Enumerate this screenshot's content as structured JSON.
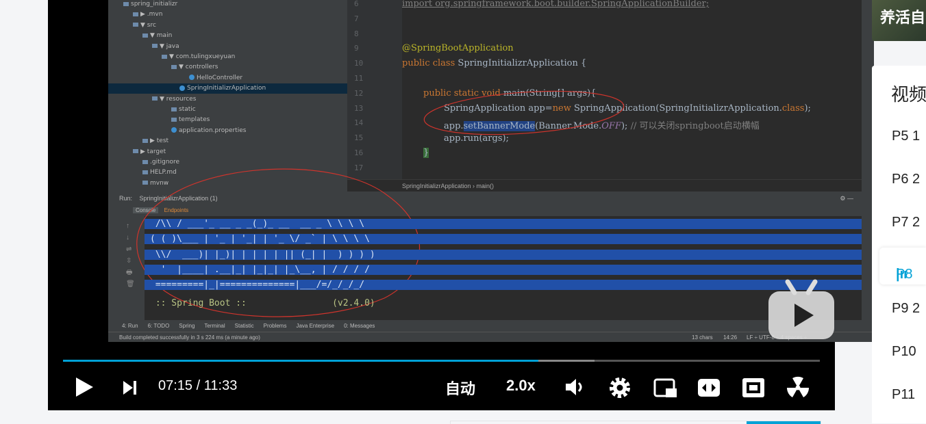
{
  "project_tree": [
    {
      "label": "spring_initializr",
      "indent": 22,
      "sel": false,
      "icon": "folder"
    },
    {
      "label": "▶ .mvn",
      "indent": 36,
      "sel": false,
      "icon": "folder"
    },
    {
      "label": "▼ src",
      "indent": 36,
      "sel": false,
      "icon": "folder"
    },
    {
      "label": "▼ main",
      "indent": 50,
      "sel": false,
      "icon": "folder"
    },
    {
      "label": "▼ java",
      "indent": 64,
      "sel": false,
      "icon": "folder"
    },
    {
      "label": "▼ com.tulingxueyuan",
      "indent": 78,
      "sel": false,
      "icon": "folder"
    },
    {
      "label": "▼ controllers",
      "indent": 92,
      "sel": false,
      "icon": "folder"
    },
    {
      "label": "HelloController",
      "indent": 118,
      "sel": false,
      "icon": "class"
    },
    {
      "label": "SpringInitializrApplication",
      "indent": 104,
      "sel": true,
      "icon": "class"
    },
    {
      "label": "▼ resources",
      "indent": 64,
      "sel": false,
      "icon": "folder"
    },
    {
      "label": "static",
      "indent": 92,
      "sel": false,
      "icon": "folder"
    },
    {
      "label": "templates",
      "indent": 92,
      "sel": false,
      "icon": "folder"
    },
    {
      "label": "application.properties",
      "indent": 92,
      "sel": false,
      "icon": "class"
    },
    {
      "label": "▶ test",
      "indent": 50,
      "sel": false,
      "icon": "folder"
    },
    {
      "label": "▶ target",
      "indent": 36,
      "sel": false,
      "icon": "folder"
    },
    {
      "label": ".gitignore",
      "indent": 50,
      "sel": false,
      "icon": "file"
    },
    {
      "label": "HELP.md",
      "indent": 50,
      "sel": false,
      "icon": "file"
    },
    {
      "label": "mvnw",
      "indent": 50,
      "sel": false,
      "icon": "file"
    }
  ],
  "editor": {
    "line_numbers": [
      "6",
      "7",
      "8",
      "9",
      "10",
      "11",
      "12",
      "13",
      "14",
      "15",
      "16",
      "17"
    ],
    "import_line": "import org.springframework.boot.builder.SpringApplicationBuilder;",
    "annotation": "@SpringBootApplication",
    "class_kw": "public class ",
    "class_name": "SpringInitializrApplication {",
    "main_kw": "public static void ",
    "main_sig": "main(String[] args){",
    "line13_a": "SpringApplication app=",
    "line13_new": "new ",
    "line13_b": "SpringApplication(SpringInitializrApplication.",
    "line13_class": "class",
    "line13_c": ");",
    "line14_a": "app.",
    "line14_sel": "setBannerMode",
    "line14_b": "(Banner.Mode.",
    "line14_off": "OFF",
    "line14_c": "); ",
    "line14_comment": "// 可以关闭springboot启动横幅",
    "line15": "app.run(args);",
    "line16": "}",
    "breadcrumb": "SpringInitializrApplication  ›  main()"
  },
  "run_panel": {
    "run_label": "Run:",
    "run_tab": "SpringInitializrApplication (1)",
    "console_tab": "Console",
    "endpoints_tab": "Endpoints",
    "banner": [
      "  .   ____          _            __ _ _",
      " /\\\\ / ___'_ __ _ _(_)_ __  __ _ \\ \\ \\ \\",
      "( ( )\\___ | '_ | '_| | '_ \\/ _` | \\ \\ \\ \\",
      " \\\\/  ___)| |_)| | | | | || (_| |  ) ) ) )",
      "  '  |____| .__|_| |_|_| |_\\__, | / / / /",
      " =========|_|==============|___/=/_/_/_/"
    ],
    "spring_boot": " :: Spring Boot ::                (v2.4.0)"
  },
  "tool_windows": [
    "4: Run",
    "6: TODO",
    "Spring",
    "Terminal",
    "Statistic",
    "Problems",
    "Java Enterprise",
    "0: Messages"
  ],
  "status_bar": {
    "message": "Build completed successfully in 3 s 224 ms (a minute ago)",
    "chars": "13 chars",
    "pos": "14:26",
    "enc": "LF ÷ UTF-8 ÷ 4 spaces ÷"
  },
  "controls": {
    "current_time": "07:15",
    "separator": "/",
    "total_time": "11:33",
    "quality": "自动",
    "speed": "2.0x",
    "progress_fraction": 0.628,
    "buffered_fraction": 0.702
  },
  "sidebar": {
    "thumb_text": "养活自",
    "section_title": "视频",
    "items": [
      "P5  1",
      "P6  2",
      "P7  2",
      "P8",
      "P9  2",
      "P10",
      "P11"
    ]
  },
  "colors": {
    "accent": "#00a1d6",
    "console_selection": "#2150a8",
    "red_annotation": "#d0342c"
  }
}
